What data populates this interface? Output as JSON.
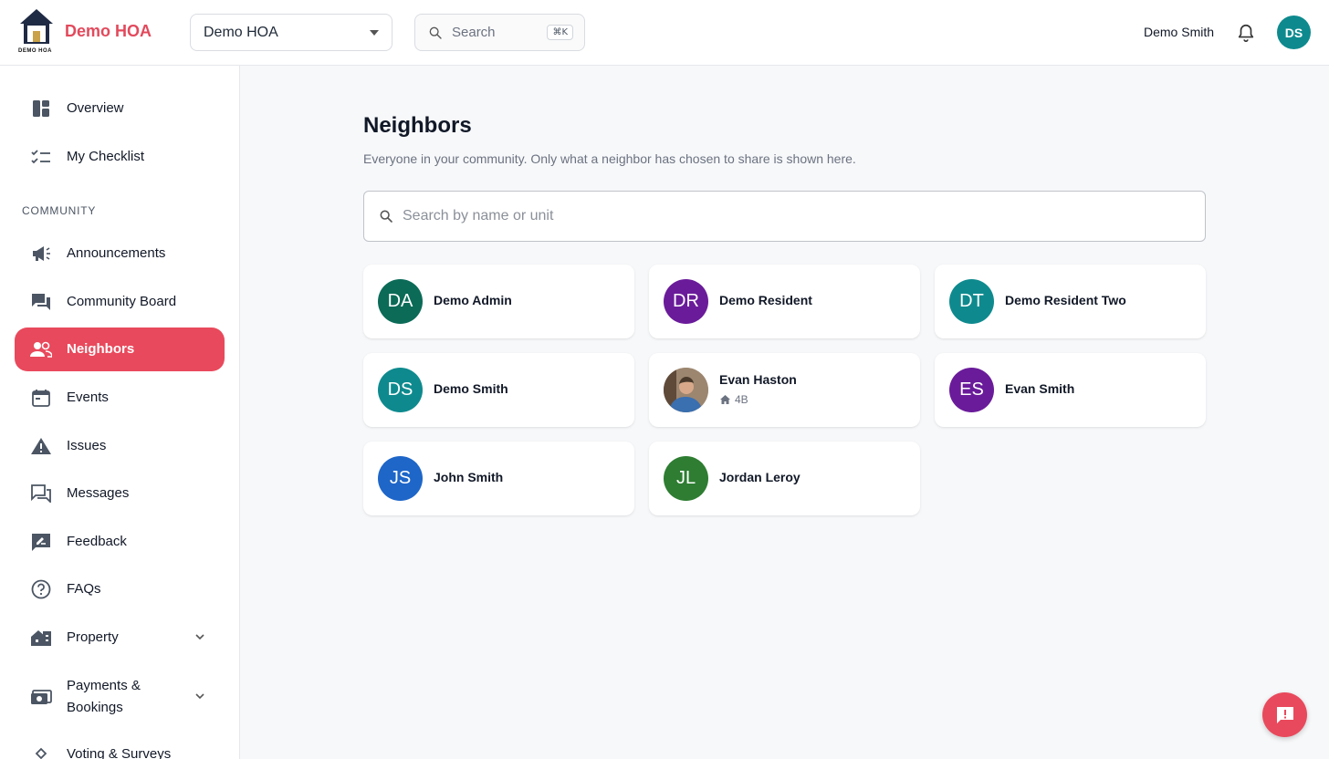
{
  "header": {
    "brand": "Demo HOA",
    "logo_caption": "DEMO HOA",
    "hoa_selector": "Demo HOA",
    "search_label": "Search",
    "search_shortcut": "⌘K",
    "user_name": "Demo Smith",
    "user_initials": "DS"
  },
  "sidebar": {
    "top_items": [
      {
        "label": "Overview",
        "icon": "dashboard-icon"
      },
      {
        "label": "My Checklist",
        "icon": "checklist-icon"
      }
    ],
    "section_label": "COMMUNITY",
    "items": [
      {
        "label": "Announcements",
        "icon": "megaphone-icon"
      },
      {
        "label": "Community Board",
        "icon": "forum-icon"
      },
      {
        "label": "Neighbors",
        "icon": "people-icon",
        "active": true
      },
      {
        "label": "Events",
        "icon": "calendar-icon"
      },
      {
        "label": "Issues",
        "icon": "warning-icon"
      },
      {
        "label": "Messages",
        "icon": "messages-icon"
      },
      {
        "label": "Feedback",
        "icon": "feedback-icon"
      },
      {
        "label": "FAQs",
        "icon": "help-icon"
      },
      {
        "label": "Property",
        "icon": "building-icon",
        "expandable": true
      },
      {
        "label": "Payments & Bookings",
        "icon": "payments-icon",
        "expandable": true
      },
      {
        "label": "Voting & Surveys",
        "icon": "vote-icon"
      }
    ]
  },
  "main": {
    "title": "Neighbors",
    "subtitle": "Everyone in your community. Only what a neighbor has chosen to share is shown here.",
    "search_placeholder": "Search by name or unit",
    "neighbors": [
      {
        "initials": "DA",
        "name": "Demo Admin",
        "color": "#0b6b57"
      },
      {
        "initials": "DR",
        "name": "Demo Resident",
        "color": "#6a1b9a"
      },
      {
        "initials": "DT",
        "name": "Demo Resident Two",
        "color": "#0e8a8e"
      },
      {
        "initials": "DS",
        "name": "Demo Smith",
        "color": "#0e8a8e"
      },
      {
        "initials": "",
        "name": "Evan Haston",
        "unit": "4B",
        "photo": true,
        "color": "#3a6fb0"
      },
      {
        "initials": "ES",
        "name": "Evan Smith",
        "color": "#6a1b9a"
      },
      {
        "initials": "JS",
        "name": "John Smith",
        "color": "#1e66c8"
      },
      {
        "initials": "JL",
        "name": "Jordan Leroy",
        "color": "#2e7d32"
      }
    ]
  },
  "colors": {
    "accent": "#e9495c",
    "brand_text": "#e24a5c"
  }
}
